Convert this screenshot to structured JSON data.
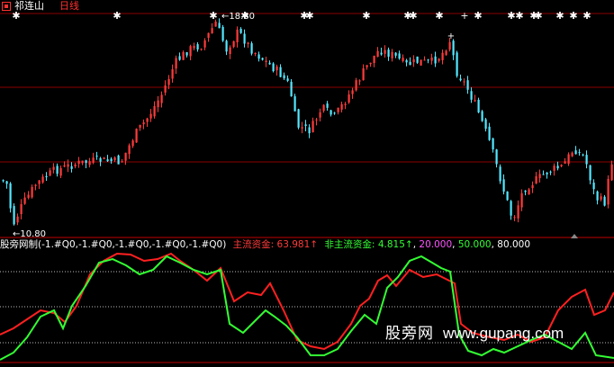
{
  "header": {
    "stock_name": "祁连山",
    "period": "日线"
  },
  "price_labels": {
    "high": "←18.80",
    "low": "←10.80"
  },
  "indicator": {
    "name": "股旁网制",
    "params": "(-1.#Q0,-1.#Q0,-1.#Q0,-1.#Q0,-1.#Q0)",
    "main_label": "主流资金:",
    "main_value": "63.981",
    "main_arrow": "↑",
    "nonmain_label": "非主流资金:",
    "nonmain_value": "4.815",
    "nonmain_arrow": "↑",
    "level1": "20.000",
    "level2": "50.000",
    "level3": "80.000"
  },
  "watermark": {
    "cn": "股旁网",
    "en": "www.gupang.com"
  },
  "colors": {
    "up": "#ff3b3b",
    "down": "#54e8ff",
    "main_line": "#ff2020",
    "nonmain_line": "#33ff33",
    "level_20": "#ff55ff",
    "level_50": "#ffffff",
    "level_80": "#ffffff",
    "grid": "#8b0000"
  }
}
